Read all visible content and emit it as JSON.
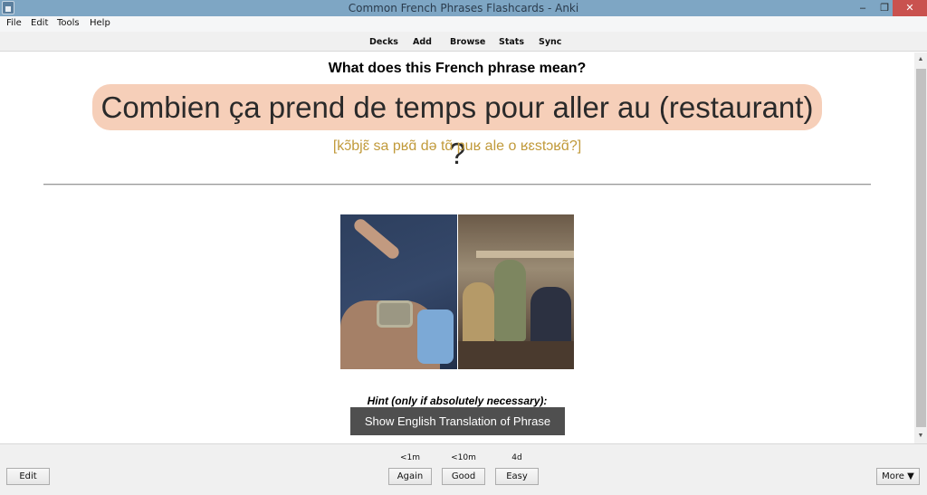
{
  "window": {
    "title": "Common French Phrases Flashcards - Anki",
    "minimize_glyph": "–",
    "maximize_glyph": "❐",
    "close_glyph": "✕"
  },
  "menu": [
    "File",
    "Edit",
    "Tools",
    "Help"
  ],
  "toolbar": [
    "Decks",
    "Add",
    "Browse",
    "Stats",
    "Sync"
  ],
  "card": {
    "question": "What does this French phrase mean?",
    "phrase": "Combien ça prend de temps pour aller au (restaurant) ?",
    "ipa": "[kɔ̃bjɛ̃ sa pʁɑ̃ də tɑ̃ puʁ ale o ʁɛstɔʁɑ̃?]",
    "hint_label": "Hint (only if absolutely necessary):",
    "hint_button": "Show English Translation of Phrase"
  },
  "colors": {
    "phrase_pill": "#f6cfb9",
    "ipa_text": "#c19a3b",
    "hint_button_bg": "#4f4f4f",
    "titlebar": "#7ea6c4",
    "close_button": "#c9524f"
  },
  "scrollbar": {
    "up_glyph": "▲",
    "down_glyph": "▼"
  },
  "bottom": {
    "edit": "Edit",
    "more": "More ▼",
    "answers": [
      {
        "due": "<1m",
        "label": "Again"
      },
      {
        "due": "<10m",
        "label": "Good"
      },
      {
        "due": "4d",
        "label": "Easy"
      }
    ]
  }
}
